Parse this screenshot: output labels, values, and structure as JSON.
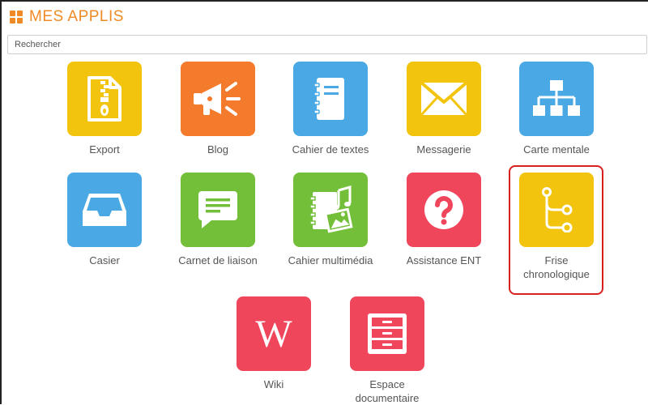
{
  "header": {
    "title": "MES APPLIS",
    "icon": "grid-icon",
    "accent": "#f08a24"
  },
  "search": {
    "placeholder": "Rechercher"
  },
  "apps": [
    {
      "label": "Export",
      "icon": "zip-file-icon",
      "color": "#f2c40e"
    },
    {
      "label": "Blog",
      "icon": "megaphone-icon",
      "color": "#f47a2c"
    },
    {
      "label": "Cahier de textes",
      "icon": "notebook-icon",
      "color": "#4aa9e4"
    },
    {
      "label": "Messagerie",
      "icon": "envelope-icon",
      "color": "#f2c40e"
    },
    {
      "label": "Carte mentale",
      "icon": "org-chart-icon",
      "color": "#4aa9e4"
    },
    {
      "label": "Casier",
      "icon": "inbox-tray-icon",
      "color": "#4aa9e4"
    },
    {
      "label": "Carnet de liaison",
      "icon": "speech-bubble-icon",
      "color": "#74bf3a"
    },
    {
      "label": "Cahier multimédia",
      "icon": "multimedia-notebook-icon",
      "color": "#74bf3a"
    },
    {
      "label": "Assistance ENT",
      "icon": "question-icon",
      "color": "#f0465c"
    },
    {
      "label": "Frise\nchronologique",
      "label_line1": "Frise",
      "label_line2": "chronologique",
      "icon": "timeline-branch-icon",
      "color": "#f2c40e",
      "selected": true,
      "highlight_color": "#d8201f"
    },
    {
      "label": "Wiki",
      "icon": "wikipedia-icon",
      "color": "#f0465c"
    },
    {
      "label_line1": "Espace",
      "label_line2": "documentaire",
      "icon": "filing-cabinet-icon",
      "color": "#f0465c"
    }
  ]
}
